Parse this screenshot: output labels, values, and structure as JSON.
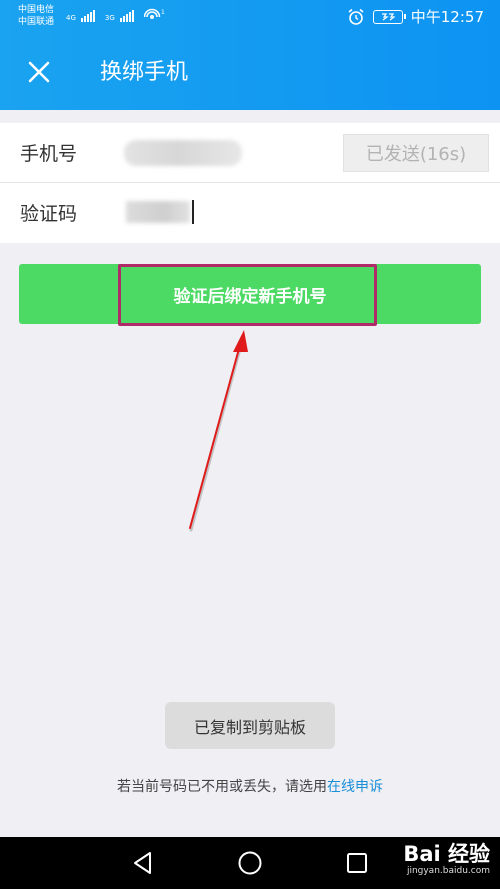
{
  "status_bar": {
    "carrier_1": "中国电信",
    "carrier_2": "中国联通",
    "net_1": "4G",
    "net_2": "3G",
    "time": "中午12:57",
    "battery_level": 1.0
  },
  "app_bar": {
    "title": "换绑手机",
    "close_icon": "close-icon"
  },
  "form": {
    "phone_label": "手机号",
    "send_button_label": "已发送(16s)",
    "code_label": "验证码"
  },
  "verify_button": {
    "label": "验证后绑定新手机号",
    "color": "#4cd964"
  },
  "annotation": {
    "highlight_color": "#b02a6a",
    "arrow_color": "#e01b1b"
  },
  "toast": {
    "text": "已复制到剪贴板"
  },
  "footer": {
    "text": "若当前号码已不用或丢失，请选用",
    "link": "在线申诉",
    "link_color": "#1a8fd8"
  },
  "nav_bar": {
    "back_icon": "triangle-back-icon",
    "home_icon": "circle-home-icon",
    "recent_icon": "square-recent-icon"
  },
  "watermark": {
    "brand": "Bai 经验",
    "url": "jingyan.baidu.com"
  }
}
